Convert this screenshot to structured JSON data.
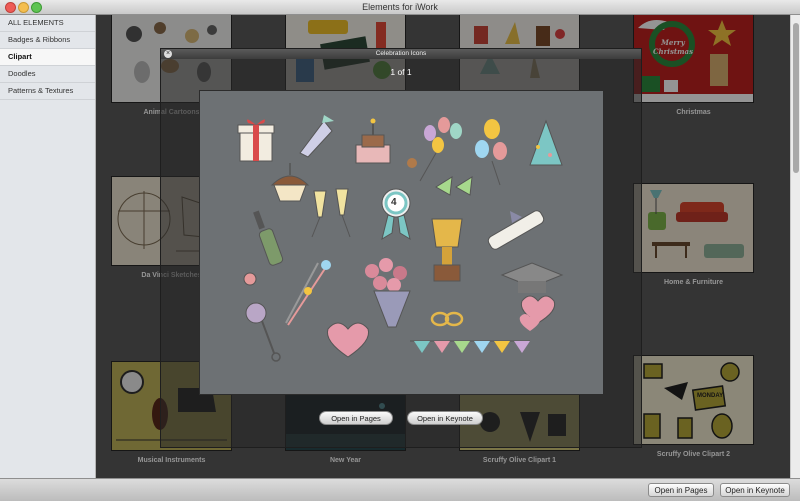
{
  "window": {
    "title": "Elements for iWork"
  },
  "sidebar": {
    "items": [
      {
        "label": "ALL ELEMENTS"
      },
      {
        "label": "Badges & Ribbons"
      },
      {
        "label": "Clipart"
      },
      {
        "label": "Doodles"
      },
      {
        "label": "Patterns & Textures"
      }
    ],
    "selected_index": 2
  },
  "grid": {
    "items": [
      {
        "label": "Animal Cartoons"
      },
      {
        "label": ""
      },
      {
        "label": ""
      },
      {
        "label": "Christmas",
        "thumb_text": "Merry Christmas"
      },
      {
        "label": "Da Vinci Sketches"
      },
      {
        "label": "Home & Furniture"
      },
      {
        "label": "Musical Instruments"
      },
      {
        "label": "New Year"
      },
      {
        "label": "Scruffy Olive Clipart 1"
      },
      {
        "label": "Scruffy Olive Clipart 2",
        "thumb_text": "MONDAY"
      }
    ]
  },
  "popup": {
    "title": "Celebration Icons",
    "page_indicator": "1 of 1",
    "open_pages_label": "Open in Pages",
    "open_keynote_label": "Open in Keynote",
    "preview_number": "4"
  },
  "bottombar": {
    "open_pages_label": "Open in Pages",
    "open_keynote_label": "Open in Keynote"
  },
  "colors": {
    "main_bg": "#5b5b5b",
    "sidebar_bg": "#e3e6ea",
    "christmas_red": "#c0221f",
    "olive": "#b7a93a"
  }
}
